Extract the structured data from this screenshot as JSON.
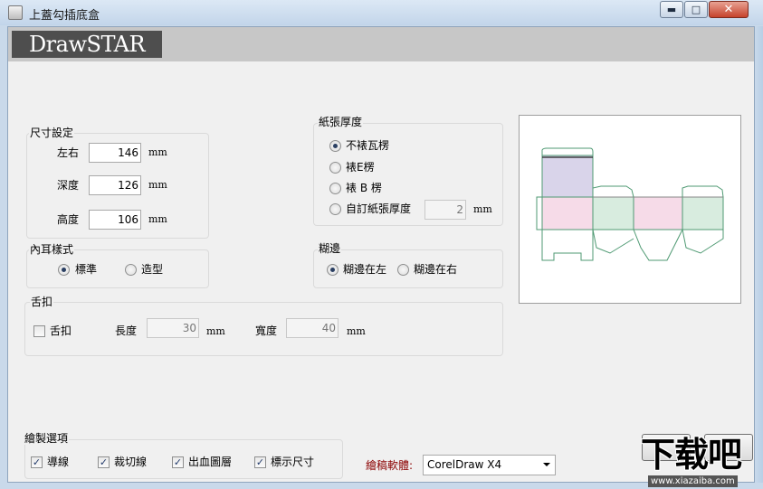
{
  "window": {
    "title": "上蓋勾插底盒",
    "minimize": "▬",
    "maximize": "□",
    "close": "✕"
  },
  "banner": {
    "logo": "DrawSTAR"
  },
  "size": {
    "label": "尺寸設定",
    "fields": [
      {
        "label": "左右",
        "value": "146",
        "unit": "mm"
      },
      {
        "label": "深度",
        "value": "126",
        "unit": "mm"
      },
      {
        "label": "高度",
        "value": "106",
        "unit": "mm"
      }
    ]
  },
  "paper": {
    "label": "紙張厚度",
    "options": [
      "不裱瓦楞",
      "裱E楞",
      "裱 B 楞",
      "自訂紙張厚度"
    ],
    "selected": 0,
    "custom_value": "2",
    "unit": "mm"
  },
  "inner_ear": {
    "label": "內耳樣式",
    "options": [
      "標準",
      "造型"
    ],
    "selected": 0
  },
  "glue": {
    "label": "糊邊",
    "options": [
      "糊邊在左",
      "糊邊在右"
    ],
    "selected": 0
  },
  "tongue": {
    "label": "舌扣",
    "checkbox": "舌扣",
    "checked": false,
    "length_label": "長度",
    "length_value": "30",
    "width_label": "寬度",
    "width_value": "40",
    "unit": "mm"
  },
  "draw_options": {
    "label": "繪製選項",
    "items": [
      {
        "label": "導線",
        "checked": true
      },
      {
        "label": "裁切線",
        "checked": true
      },
      {
        "label": "出血圖層",
        "checked": true
      },
      {
        "label": "標示尺寸",
        "checked": true
      }
    ]
  },
  "software": {
    "label": "繪稿軟體:",
    "value": "CorelDraw X4",
    "label_color": "#8b0000"
  },
  "watermark": {
    "main": "下载吧",
    "site": "www.xiazaiba.com"
  },
  "colors": {
    "face_purple": "#d9d4ea",
    "face_pink": "#f6dbe8",
    "face_green": "#d8ecdf",
    "outline": "#4f9a73"
  }
}
